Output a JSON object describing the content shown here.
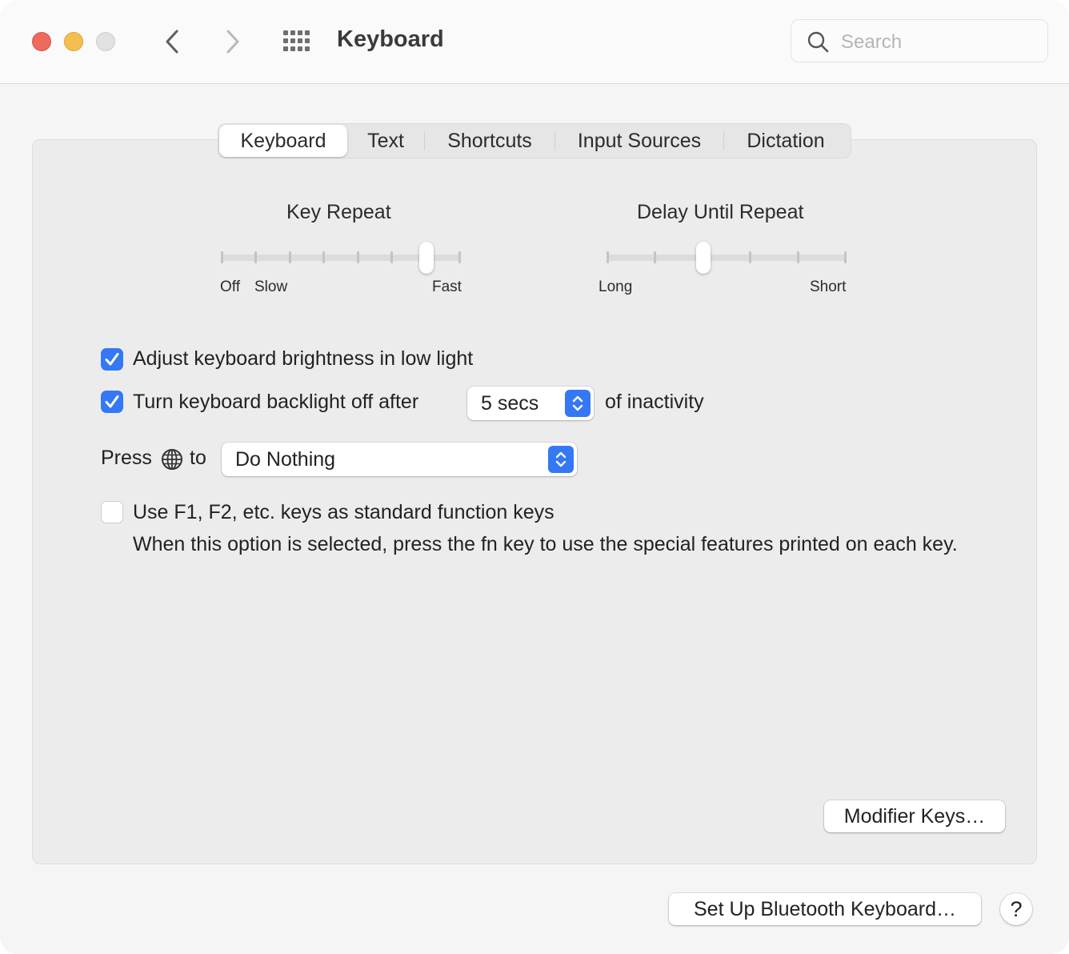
{
  "window": {
    "title": "Keyboard",
    "traffic_lights": [
      "close",
      "minimize",
      "zoom"
    ],
    "nav": {
      "back_icon": "chevron-left-icon",
      "forward_icon": "chevron-right-icon",
      "show_all_icon": "grid-icon"
    },
    "search": {
      "placeholder": "Search",
      "value": ""
    }
  },
  "tabs": [
    {
      "label": "Keyboard",
      "active": true
    },
    {
      "label": "Text",
      "active": false
    },
    {
      "label": "Shortcuts",
      "active": false
    },
    {
      "label": "Input Sources",
      "active": false
    },
    {
      "label": "Dictation",
      "active": false
    }
  ],
  "sliders": {
    "key_repeat": {
      "title": "Key Repeat",
      "labels": {
        "off": "Off",
        "slow": "Slow",
        "fast": "Fast"
      },
      "steps": 8,
      "selected_step": 7
    },
    "delay_until_repeat": {
      "title": "Delay Until Repeat",
      "labels": {
        "long": "Long",
        "short": "Short"
      },
      "steps": 6,
      "selected_step": 3
    }
  },
  "options": {
    "adjust_brightness": {
      "label": "Adjust keyboard brightness in low light",
      "checked": true
    },
    "backlight_off": {
      "label": "Turn keyboard backlight off after",
      "checked": true,
      "duration": "5 secs",
      "suffix": "of inactivity"
    },
    "press_globe": {
      "prefix": "Press",
      "icon": "globe-icon",
      "suffix": "to",
      "value": "Do Nothing"
    },
    "function_keys": {
      "label": "Use F1, F2, etc. keys as standard function keys",
      "checked": false,
      "description": "When this option is selected, press the fn key to use the special features printed on each key."
    }
  },
  "buttons": {
    "modifier_keys": "Modifier Keys…",
    "bluetooth": "Set Up Bluetooth Keyboard…",
    "help": "?"
  },
  "colors": {
    "accent": "#3478f6",
    "close": "#ee6a5e",
    "minimize": "#f5bf4f",
    "inactive": "#e1e1e1"
  }
}
